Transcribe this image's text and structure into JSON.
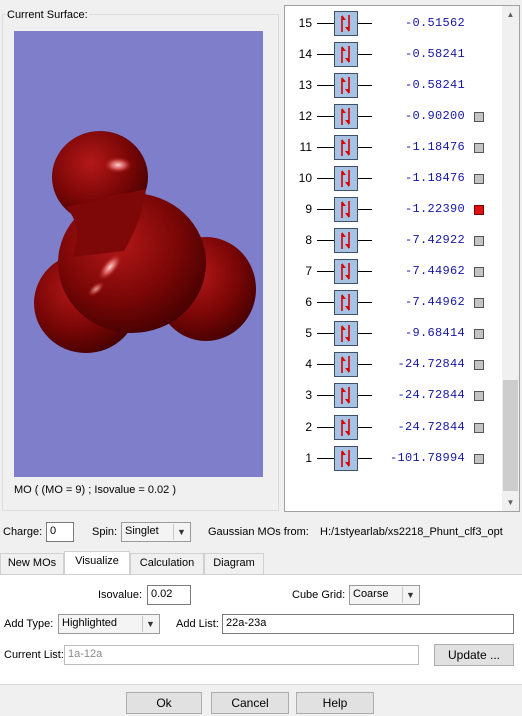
{
  "surface": {
    "group_label": "Current Surface:",
    "caption": "MO ( (MO = 9) ; Isovalue = 0.02 )",
    "colors": {
      "background": "#7e7ecb",
      "lobe": "#8a0a0a"
    }
  },
  "mo_list": {
    "rows": [
      {
        "num": "15",
        "energy": "-0.51562",
        "checkbox": false,
        "selected": false
      },
      {
        "num": "14",
        "energy": "-0.58241",
        "checkbox": false,
        "selected": false
      },
      {
        "num": "13",
        "energy": "-0.58241",
        "checkbox": false,
        "selected": false
      },
      {
        "num": "12",
        "energy": "-0.90200",
        "checkbox": true,
        "selected": false
      },
      {
        "num": "11",
        "energy": "-1.18476",
        "checkbox": true,
        "selected": false
      },
      {
        "num": "10",
        "energy": "-1.18476",
        "checkbox": true,
        "selected": false
      },
      {
        "num": "9",
        "energy": "-1.22390",
        "checkbox": true,
        "selected": true
      },
      {
        "num": "8",
        "energy": "-7.42922",
        "checkbox": true,
        "selected": false
      },
      {
        "num": "7",
        "energy": "-7.44962",
        "checkbox": true,
        "selected": false
      },
      {
        "num": "6",
        "energy": "-7.44962",
        "checkbox": true,
        "selected": false
      },
      {
        "num": "5",
        "energy": "-9.68414",
        "checkbox": true,
        "selected": false
      },
      {
        "num": "4",
        "energy": "-24.72844",
        "checkbox": true,
        "selected": false
      },
      {
        "num": "3",
        "energy": "-24.72844",
        "checkbox": true,
        "selected": false
      },
      {
        "num": "2",
        "energy": "-24.72844",
        "checkbox": true,
        "selected": false
      },
      {
        "num": "1",
        "energy": "-101.78994",
        "checkbox": true,
        "selected": false
      }
    ],
    "colors": {
      "energy": "#1616a8",
      "selected": "#e01010",
      "box": "#a7c3e3"
    }
  },
  "params": {
    "charge_label": "Charge:",
    "charge_value": "0",
    "spin_label": "Spin:",
    "spin_value": "Singlet",
    "source_label": "Gaussian MOs from:",
    "source_path": "H:/1styearlab/xs2218_Phunt_clf3_opt"
  },
  "tabs": [
    {
      "label": "New MOs",
      "active": false
    },
    {
      "label": "Visualize",
      "active": true
    },
    {
      "label": "Calculation",
      "active": false
    },
    {
      "label": "Diagram",
      "active": false
    }
  ],
  "visualize": {
    "isovalue_label": "Isovalue:",
    "isovalue_value": "0.02",
    "cube_grid_label": "Cube Grid:",
    "cube_grid_value": "Coarse",
    "add_type_label": "Add Type:",
    "add_type_value": "Highlighted",
    "add_list_label": "Add List:",
    "add_list_value": "22a-23a",
    "current_list_label": "Current List:",
    "current_list_value": "1a-12a",
    "update_label": "Update ..."
  },
  "footer": {
    "ok_label": "Ok",
    "cancel_label": "Cancel",
    "help_label": "Help"
  }
}
